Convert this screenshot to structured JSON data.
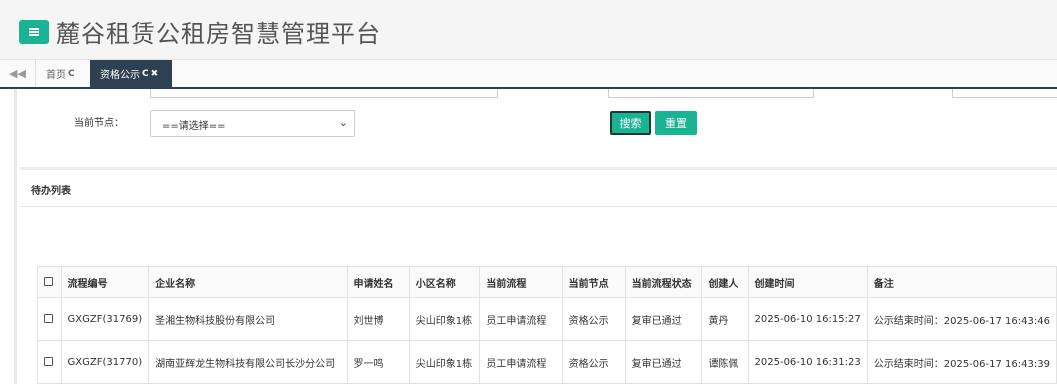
{
  "header": {
    "title": "麓谷租赁公租房智慧管理平台"
  },
  "tabs": {
    "home_label": "首页",
    "active_label": "资格公示",
    "refresh_symbol": "C",
    "close_symbol": "✖"
  },
  "filter": {
    "node_label": "当前节点：",
    "node_select_value": "==请选择==",
    "search_button": "搜索",
    "reset_button": "重置"
  },
  "list": {
    "title": "待办列表"
  },
  "table": {
    "headers": [
      "流程编号",
      "企业名称",
      "申请姓名",
      "小区名称",
      "当前流程",
      "当前节点",
      "当前流程状态",
      "创建人",
      "创建时间",
      "备注"
    ],
    "rows": [
      [
        "GXGZF(31769)",
        "圣湘生物科技股份有限公司",
        "刘世博",
        "尖山印象1栋",
        "员工申请流程",
        "资格公示",
        "复审已通过",
        "黄丹",
        "2025-06-10 16:15:27",
        "公示结束时间：2025-06-17 16:43:46"
      ],
      [
        "GXGZF(31770)",
        "湖南亚辉龙生物科技有限公司长沙分公司",
        "罗一鸣",
        "尖山印象1栋",
        "员工申请流程",
        "资格公示",
        "复审已通过",
        "谭陈佩",
        "2025-06-10 16:31:23",
        "公示结束时间：2025-06-17 16:43:39"
      ]
    ]
  }
}
